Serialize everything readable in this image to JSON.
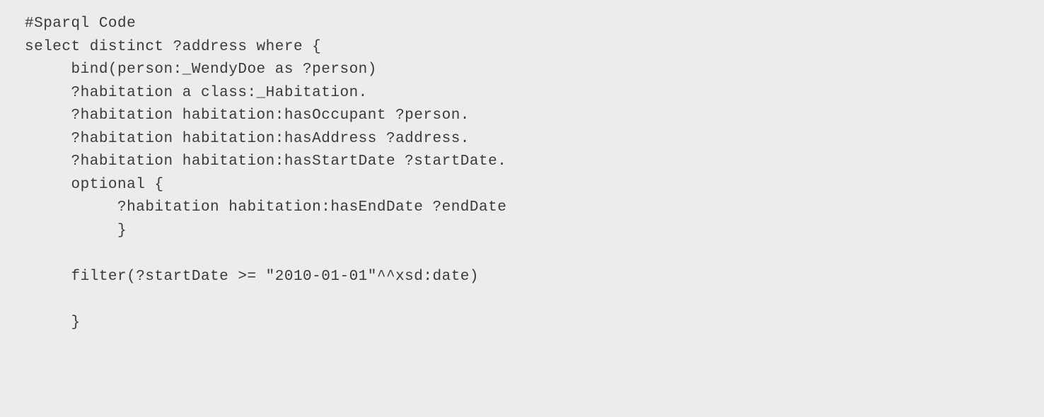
{
  "code": {
    "lines": [
      "#Sparql Code",
      "select distinct ?address where {",
      "     bind(person:_WendyDoe as ?person)",
      "     ?habitation a class:_Habitation.",
      "     ?habitation habitation:hasOccupant ?person.",
      "     ?habitation habitation:hasAddress ?address.",
      "     ?habitation habitation:hasStartDate ?startDate.",
      "     optional {",
      "          ?habitation habitation:hasEndDate ?endDate",
      "          }",
      "",
      "     filter(?startDate >= \"2010-01-01\"^^xsd:date)",
      "",
      "     }"
    ]
  }
}
